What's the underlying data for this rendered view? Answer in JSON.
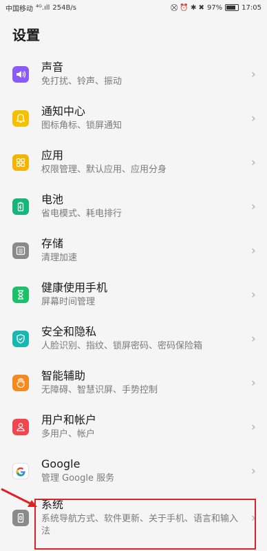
{
  "status": {
    "carrier": "中国移动",
    "signal": "⁴ᴳ.ıll",
    "speed": "254B/s",
    "icons": "⛒ ⏰ ✱ ✖",
    "battery": "97%",
    "time": "17:05"
  },
  "header": {
    "title": "设置"
  },
  "items": [
    {
      "title": "声音",
      "subtitle": "免打扰、铃声、振动",
      "icon": "sound-icon",
      "color": "#8a5cf5"
    },
    {
      "title": "通知中心",
      "subtitle": "图标角标、锁屏通知",
      "icon": "bell-icon",
      "color": "#f5c000"
    },
    {
      "title": "应用",
      "subtitle": "权限管理、默认应用、应用分身",
      "icon": "apps-icon",
      "color": "#f5b400"
    },
    {
      "title": "电池",
      "subtitle": "省电模式、耗电排行",
      "icon": "battery-icon",
      "color": "#17b57a"
    },
    {
      "title": "存储",
      "subtitle": "清理加速",
      "icon": "storage-icon",
      "color": "#8a8a8a"
    },
    {
      "title": "健康使用手机",
      "subtitle": "屏幕时间管理",
      "icon": "hourglass-icon",
      "color": "#1dbf6a"
    },
    {
      "title": "安全和隐私",
      "subtitle": "人脸识别、指纹、锁屏密码、密码保险箱",
      "icon": "shield-icon",
      "color": "#17b8b0"
    },
    {
      "title": "智能辅助",
      "subtitle": "无障碍、智慧识屏、手势控制",
      "icon": "hand-icon",
      "color": "#f58a1f"
    },
    {
      "title": "用户和帐户",
      "subtitle": "多用户、帐户",
      "icon": "user-icon",
      "color": "#f0474f"
    },
    {
      "title": "Google",
      "subtitle": "管理 Google 服务",
      "icon": "google-icon",
      "color": "#ffffff"
    },
    {
      "title": "系统",
      "subtitle": "系统导航方式、软件更新、关于手机、语言和输入法",
      "icon": "phone-icon",
      "color": "#8a8a8a"
    }
  ],
  "chevron": "›",
  "annotation_color": "#dd2222"
}
